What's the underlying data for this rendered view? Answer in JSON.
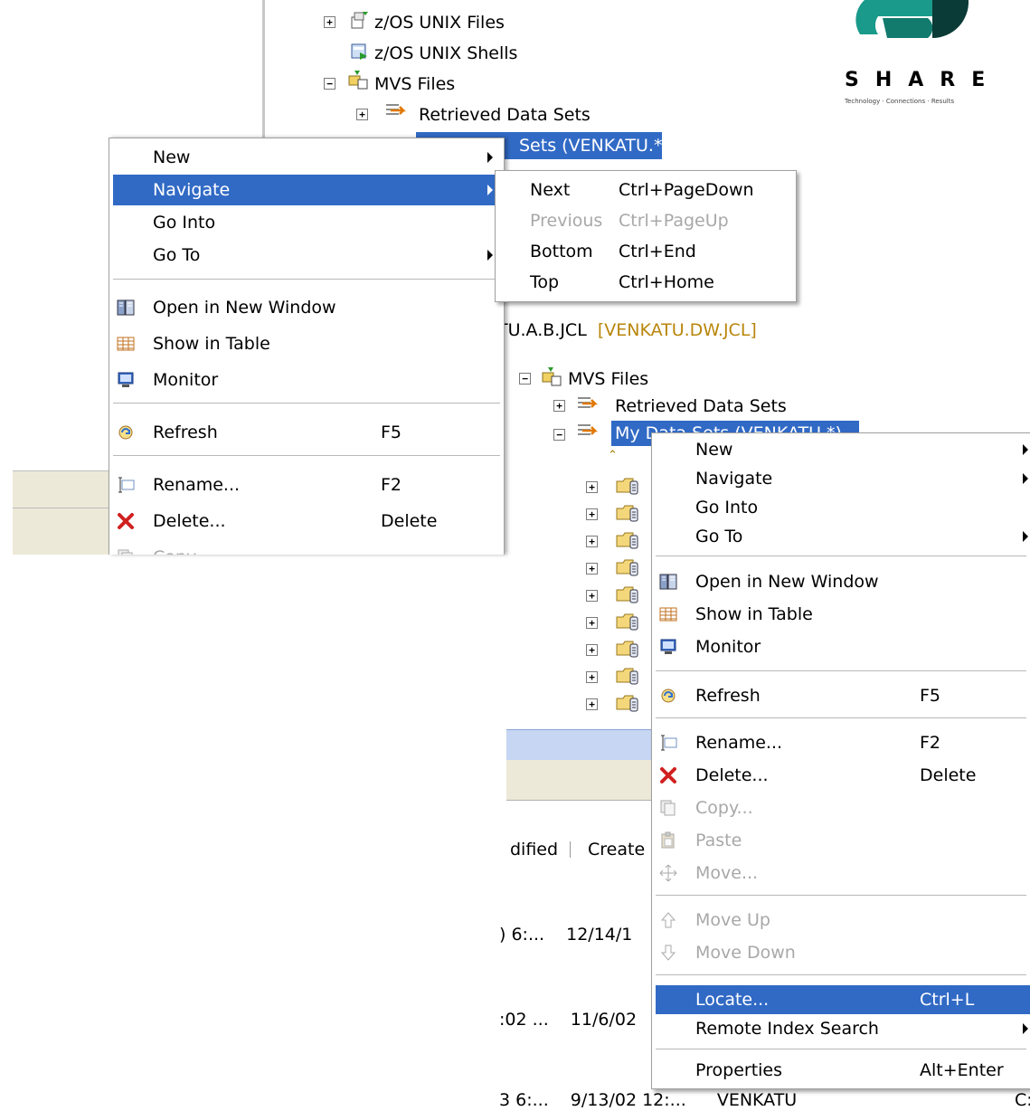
{
  "tree_top": {
    "items": [
      {
        "label": "z/OS UNIX Files"
      },
      {
        "label": "z/OS UNIX Shells"
      },
      {
        "label": "MVS Files"
      },
      {
        "label": "Retrieved Data Sets"
      },
      {
        "label": "Sets (VENKATU.*)"
      }
    ],
    "behind_row_1": "TU.A.B.JCL",
    "behind_row_1_alias": "[VENKATU.DW.JCL]"
  },
  "logo": {
    "text": "SHARE",
    "tagline": "Technology · Connections · Results"
  },
  "menu1": {
    "items": [
      {
        "label": "New"
      },
      {
        "label": "Navigate"
      },
      {
        "label": "Go Into"
      },
      {
        "label": "Go To"
      },
      {
        "label": "Open in New Window"
      },
      {
        "label": "Show in Table"
      },
      {
        "label": "Monitor"
      },
      {
        "label": "Refresh",
        "shortcut": "F5"
      },
      {
        "label": "Rename...",
        "shortcut": "F2"
      },
      {
        "label": "Delete...",
        "shortcut": "Delete"
      },
      {
        "label": "Copy"
      }
    ]
  },
  "submenu": {
    "items": [
      {
        "label": "Next",
        "shortcut": "Ctrl+PageDown"
      },
      {
        "label": "Previous",
        "shortcut": "Ctrl+PageUp"
      },
      {
        "label": "Bottom",
        "shortcut": "Ctrl+End"
      },
      {
        "label": "Top",
        "shortcut": "Ctrl+Home"
      }
    ]
  },
  "tree2": {
    "mvs": "MVS Files",
    "retrieved": "Retrieved Data Sets",
    "mydata": "My Data Sets (VENKATU.*)"
  },
  "table": {
    "headers": [
      "dified",
      "Create"
    ],
    "rows": [
      {
        "modified": ") 6:...",
        "created": "12/14/1"
      },
      {
        "modified": ":02 ...",
        "created": "11/6/02"
      },
      {
        "modified": "3 6:...",
        "created": "9/13/02 12:...",
        "owner": "VENKATU"
      }
    ]
  },
  "menu2": {
    "items": [
      {
        "label": "New"
      },
      {
        "label": "Navigate"
      },
      {
        "label": "Go Into"
      },
      {
        "label": "Go To"
      },
      {
        "label": "Open in New Window"
      },
      {
        "label": "Show in Table"
      },
      {
        "label": "Monitor"
      },
      {
        "label": "Refresh",
        "shortcut": "F5"
      },
      {
        "label": "Rename...",
        "shortcut": "F2"
      },
      {
        "label": "Delete...",
        "shortcut": "Delete"
      },
      {
        "label": "Copy..."
      },
      {
        "label": "Paste"
      },
      {
        "label": "Move..."
      },
      {
        "label": "Move Up"
      },
      {
        "label": "Move Down"
      },
      {
        "label": "Locate...",
        "shortcut": "Ctrl+L"
      },
      {
        "label": "Remote Index Search"
      },
      {
        "label": "Properties",
        "shortcut": "Alt+Enter"
      }
    ]
  }
}
